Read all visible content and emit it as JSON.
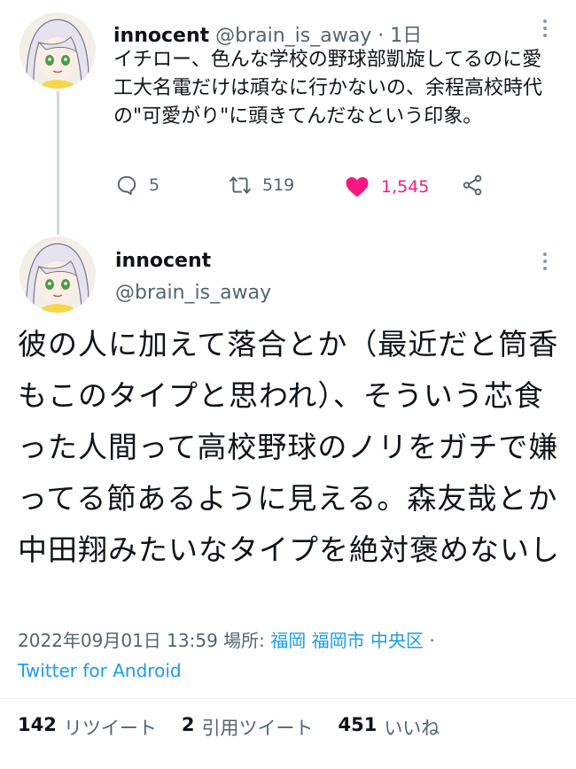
{
  "colors": {
    "accent": "#1d9bf0",
    "like": "#f91880",
    "muted": "#536471",
    "text": "#0f1419"
  },
  "tweet1": {
    "name": "innocent",
    "handle": "@brain_is_away",
    "dot": "·",
    "time": "1日",
    "text": "イチロー、色んな学校の野球部凱旋してるのに愛工大名電だけは頑なに行かないの、余程高校時代の\"可愛がり\"に頭きてんだなという印象。",
    "actions": {
      "replies": "5",
      "retweets": "519",
      "likes": "1,545"
    },
    "icons": [
      "reply-icon",
      "retweet-icon",
      "heart-icon",
      "share-icon",
      "more-icon"
    ]
  },
  "tweet2": {
    "name": "innocent",
    "handle": "@brain_is_away",
    "text": "彼の人に加えて落合とか（最近だと筒香もこのタイプと思われ）、そういう芯食った人間って高校野球のノリをガチで嫌ってる節あるように見える。森友哉とか中田翔みたいなタイプを絶対褒めないし",
    "datetime": "2022年09月01日 13:59",
    "location_label": "場所:",
    "location": "福岡 福岡市 中央区",
    "separator": "·",
    "client": "Twitter for Android",
    "stats": {
      "retweets_count": "142",
      "retweets_label": "リツイート",
      "quotes_count": "2",
      "quotes_label": "引用ツイート",
      "likes_count": "451",
      "likes_label": "いいね"
    }
  }
}
